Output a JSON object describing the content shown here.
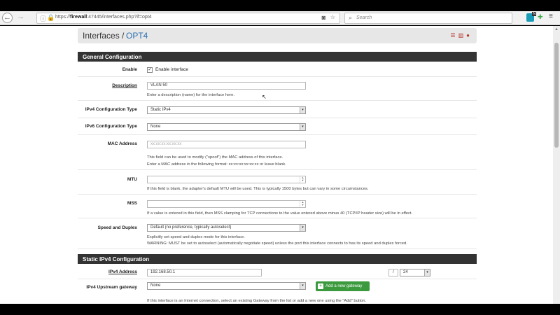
{
  "browser": {
    "url_host": "firewall",
    "url_rest": ":47445/interfaces.php?if=opt4",
    "url_scheme": "https://",
    "search_placeholder": "Search",
    "ext_badge": "N"
  },
  "breadcrumb": {
    "root": "Interfaces /",
    "current": "OPT4"
  },
  "sections": {
    "general": "General Configuration",
    "static_ipv4": "Static IPv4 Configuration"
  },
  "form": {
    "enable": {
      "label": "Enable",
      "checkbox_label": "Enable interface",
      "checked": true
    },
    "description": {
      "label": "Description",
      "value": "VLAN 50",
      "help": "Enter a description (name) for the interface here."
    },
    "ipv4_type": {
      "label": "IPv4 Configuration Type",
      "value": "Static IPv4"
    },
    "ipv6_type": {
      "label": "IPv6 Configuration Type",
      "value": "None"
    },
    "mac": {
      "label": "MAC Address",
      "placeholder": "xx:xx:xx:xx:xx:xx",
      "help1": "This field can be used to modify (\"spoof\") the MAC address of this interface.",
      "help2": "Enter a MAC address in the following format: xx:xx:xx:xx:xx:xx or leave blank."
    },
    "mtu": {
      "label": "MTU",
      "help": "If this field is blank, the adapter's default MTU will be used. This is typically 1500 bytes but can vary in some circumstances."
    },
    "mss": {
      "label": "MSS",
      "help": "If a value is entered in this field, then MSS clamping for TCP connections to the value entered above minus 40 (TCP/IP header size) will be in effect."
    },
    "speed": {
      "label": "Speed and Duplex",
      "value": "Default (no preference, typically autoselect)",
      "help1": "Explicitly set speed and duplex mode for this interface.",
      "help2": "WARNING: MUST be set to autoselect (automatically negotiate speed) unless the port this interface connects to has its speed and duplex forced."
    },
    "ipv4_addr": {
      "label": "IPv4 Address",
      "value": "192.168.50.1",
      "slash": "/",
      "prefix": "24"
    },
    "gateway": {
      "label": "IPv4 Upstream gateway",
      "value": "None",
      "add_button": "Add a new gateway",
      "help": "If this interface is an Internet connection, select an existing Gateway from the list or add a new one using the \"Add\" button."
    }
  },
  "colors": {
    "section_bg": "#333333",
    "link_blue": "#2b6fb3",
    "add_green": "#3b9a3d",
    "icon_red": "#b7342a"
  }
}
